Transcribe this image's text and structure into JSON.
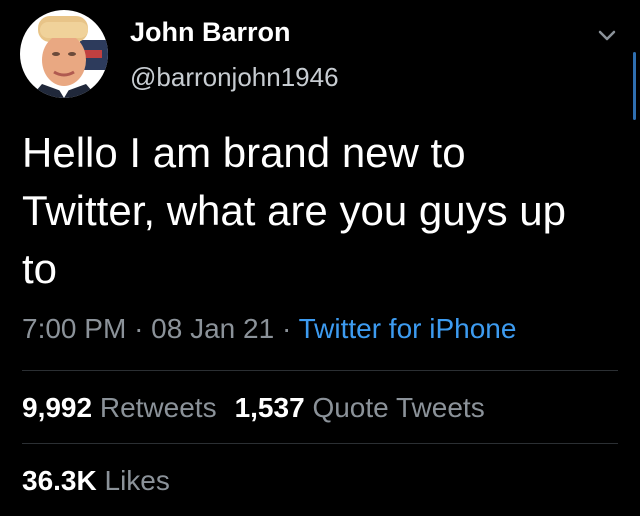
{
  "user": {
    "display_name": "John Barron",
    "handle": "@barronjohn1946",
    "avatar_icon": "profile-photo"
  },
  "tweet": {
    "text": "Hello I am brand new to Twitter, what are you guys up to",
    "time": "7:00 PM",
    "date": "08 Jan 21",
    "separator": "·",
    "source": "Twitter for iPhone"
  },
  "stats": {
    "retweets_count": "9,992",
    "retweets_label": "Retweets",
    "quote_tweets_count": "1,537",
    "quote_tweets_label": "Quote Tweets",
    "likes_count": "36.3K",
    "likes_label": "Likes"
  },
  "colors": {
    "background": "#000000",
    "link": "#3d9bf0",
    "muted": "#8b9299"
  }
}
